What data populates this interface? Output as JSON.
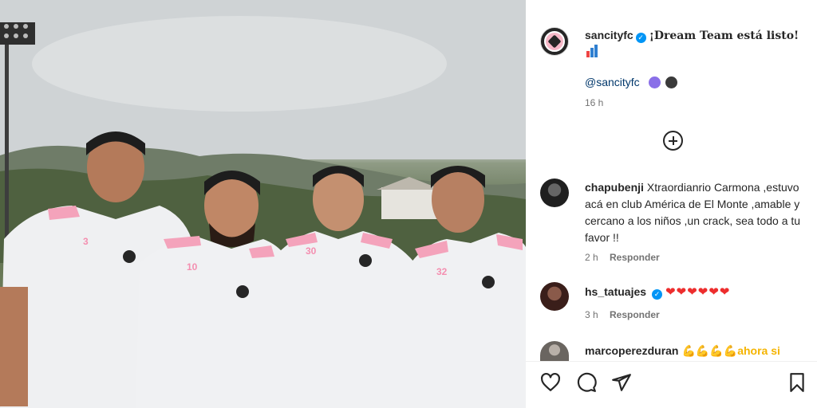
{
  "post": {
    "author": "sancityfc",
    "verified": true,
    "caption": "¡Dream Team está listo!",
    "caption_emoji": "bar-chart-emoji",
    "mention": "@sancityfc",
    "mention_dots": [
      "#8a6fe8",
      "#3a3a3a"
    ],
    "time": "16 h"
  },
  "comments": [
    {
      "username": "chapubenji",
      "verified": false,
      "text": "Xtraordianrio Carmona ,estuvo acá en club América de El Monte ,amable y cercano a los niños ,un crack, sea todo a tu favor !!",
      "time": "2 h",
      "reply_label": "Responder"
    },
    {
      "username": "hs_tatuajes",
      "verified": true,
      "text": "❤❤❤❤❤❤",
      "time": "3 h",
      "reply_label": "Responder"
    },
    {
      "username": "marcoperezduran",
      "verified": false,
      "text": "💪💪💪💪ahora si",
      "time": "",
      "reply_label": ""
    }
  ],
  "photo": {
    "jersey_numbers": [
      "3",
      "10",
      "30",
      "32"
    ]
  },
  "actions": {
    "icons": [
      "heart-icon",
      "comment-icon",
      "share-icon",
      "bookmark-icon"
    ]
  }
}
